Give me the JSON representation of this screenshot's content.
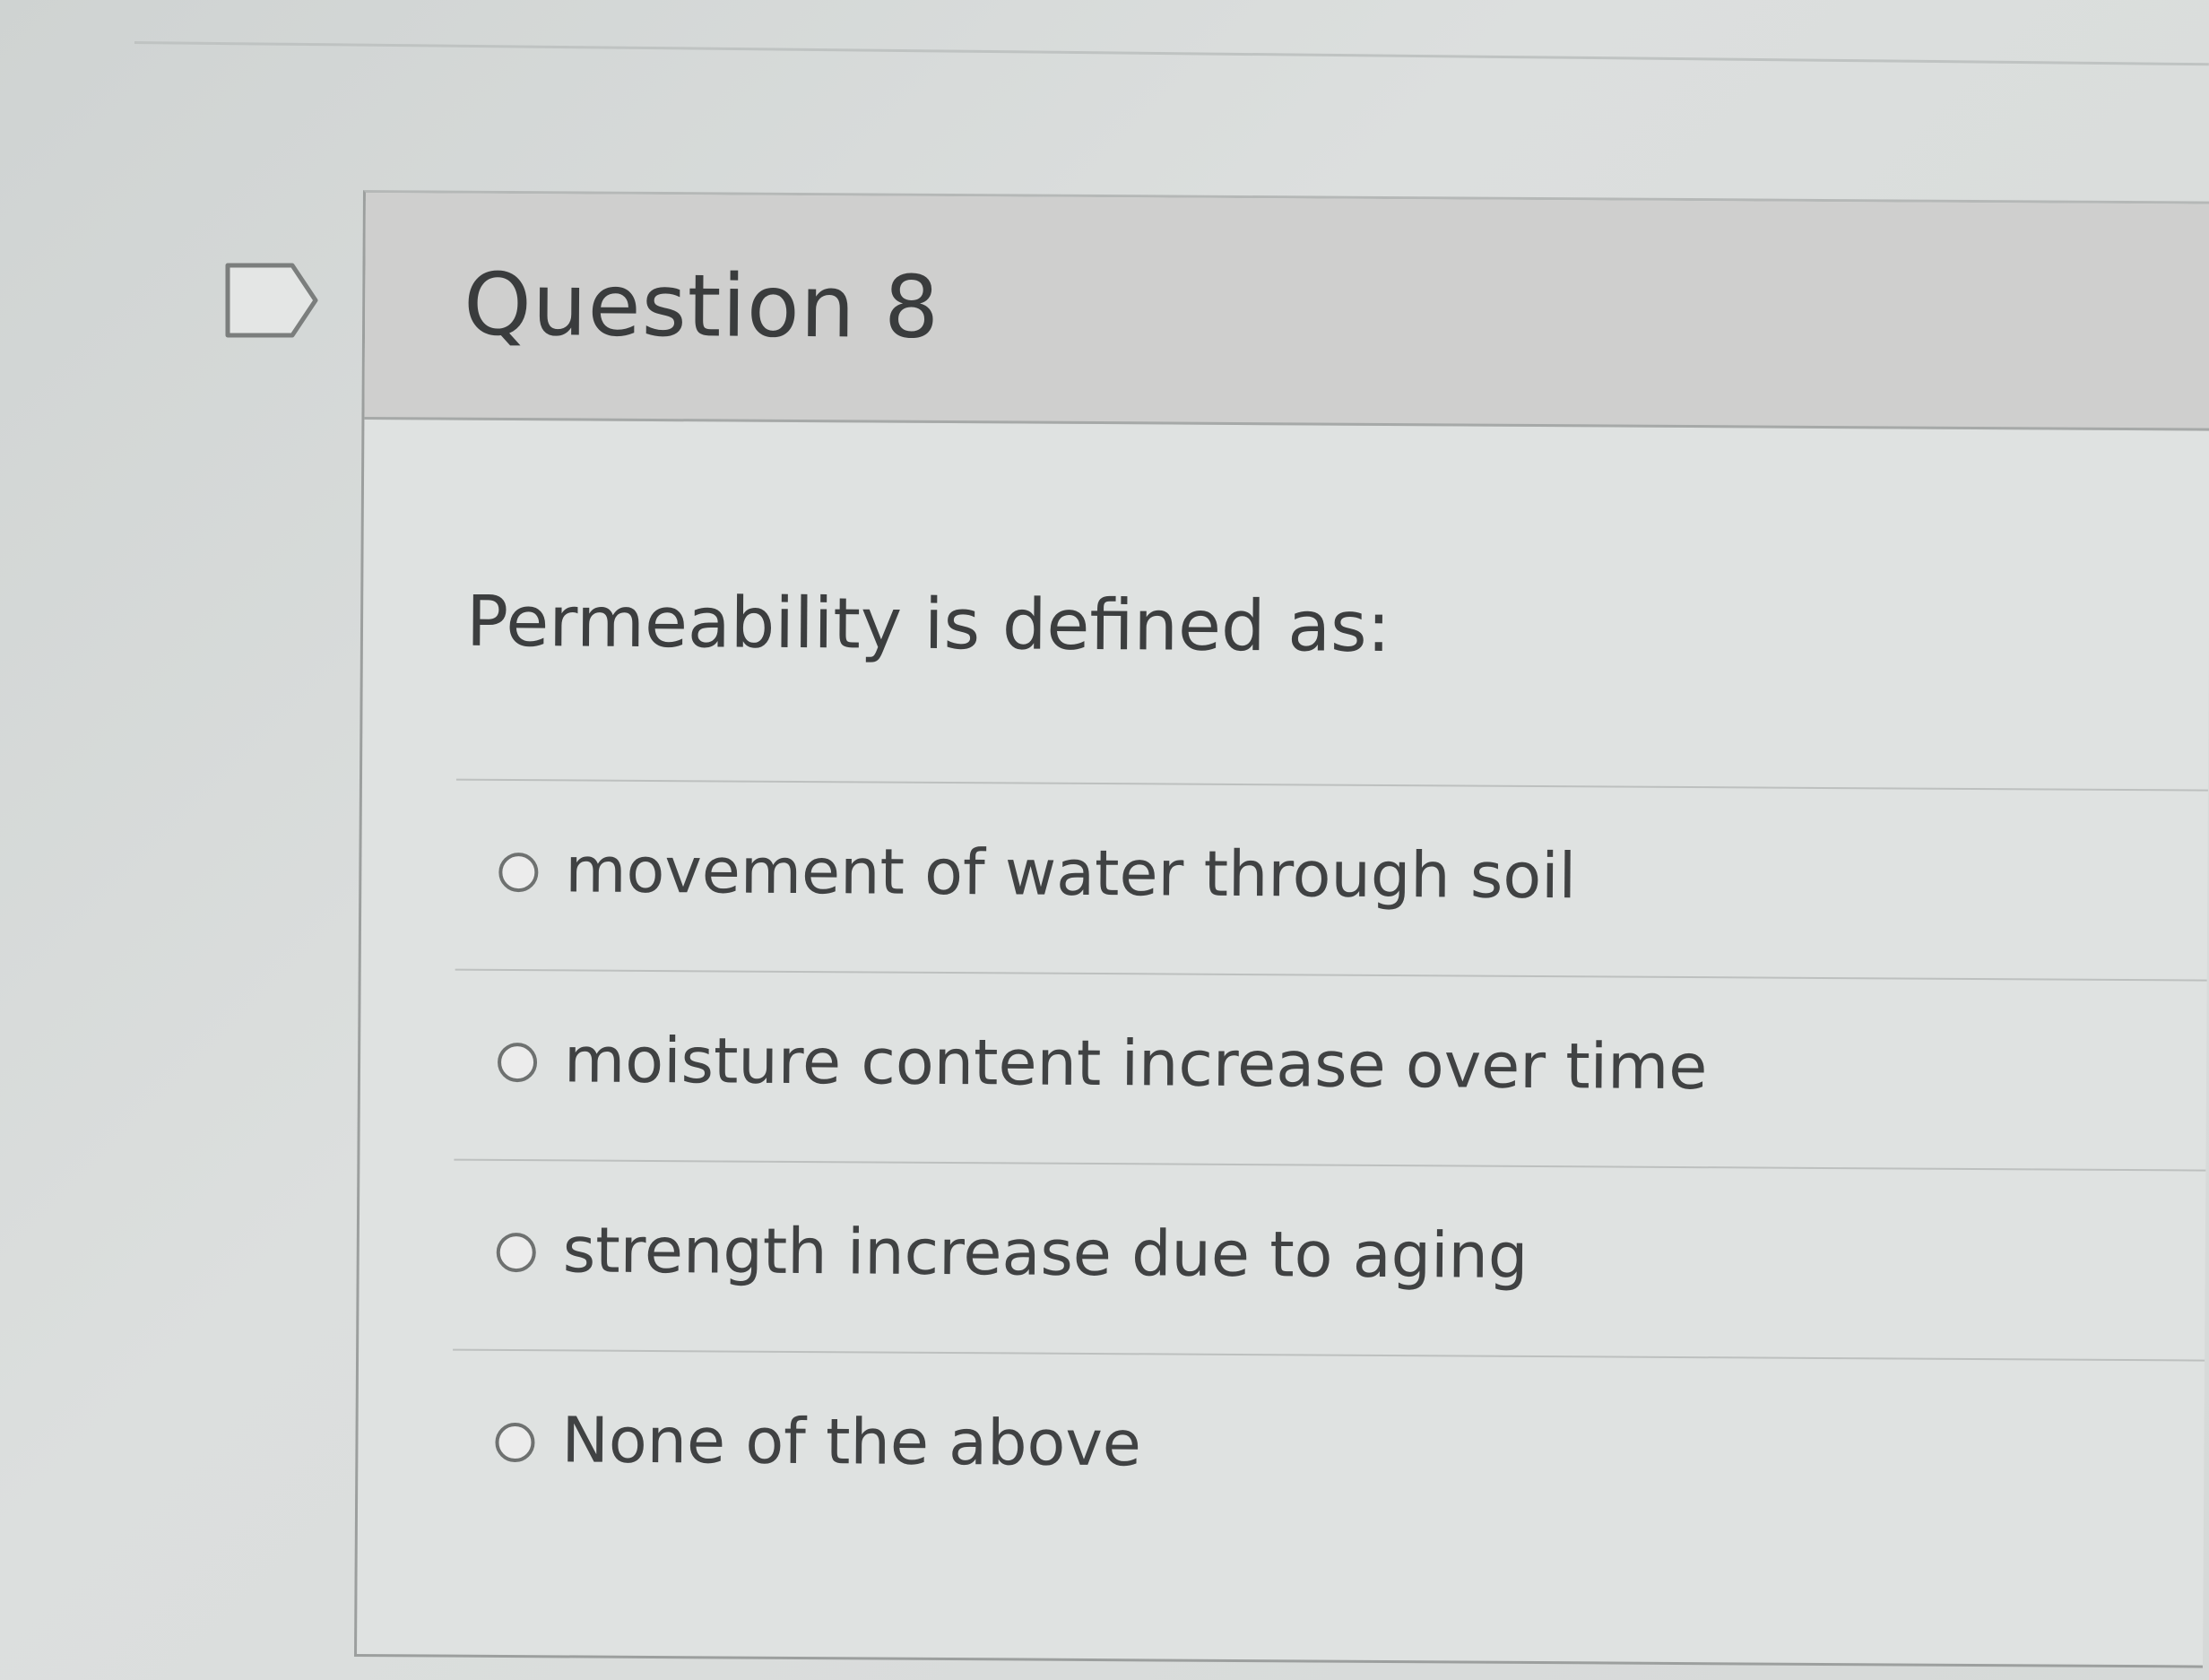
{
  "quiz": {
    "question_title": "Question 8",
    "prompt": "Permeability is defined as:",
    "answers": [
      {
        "label": "movement of water through soil",
        "selected": false
      },
      {
        "label": "moisture content increase over time",
        "selected": false
      },
      {
        "label": "strength increase due to aging",
        "selected": false
      },
      {
        "label": "None of the above",
        "selected": false
      }
    ],
    "flag_icon": "flag-outline-icon"
  }
}
